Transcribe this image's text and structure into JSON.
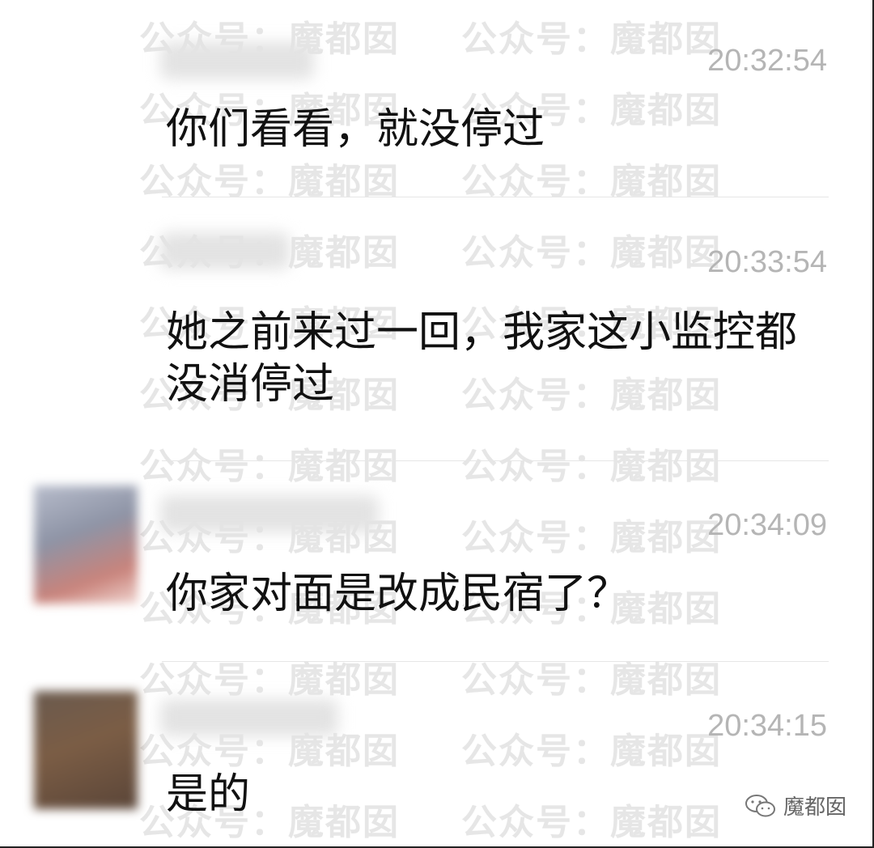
{
  "watermark_text": "公众号：魔都囡",
  "messages": [
    {
      "time": "20:32:54",
      "text": "你们看看，就没停过"
    },
    {
      "time": "20:33:54",
      "text": "她之前来过一回，我家这小监控都没消停过"
    },
    {
      "time": "20:34:09",
      "text": "你家对面是改成民宿了？"
    },
    {
      "time": "20:34:15",
      "text": "是的"
    }
  ],
  "brand": {
    "icon": "wechat-icon",
    "label": "魔都囡"
  },
  "colors": {
    "timestamp": "#b5b5b5",
    "text": "#111111",
    "watermark": "#e6e6e6"
  }
}
